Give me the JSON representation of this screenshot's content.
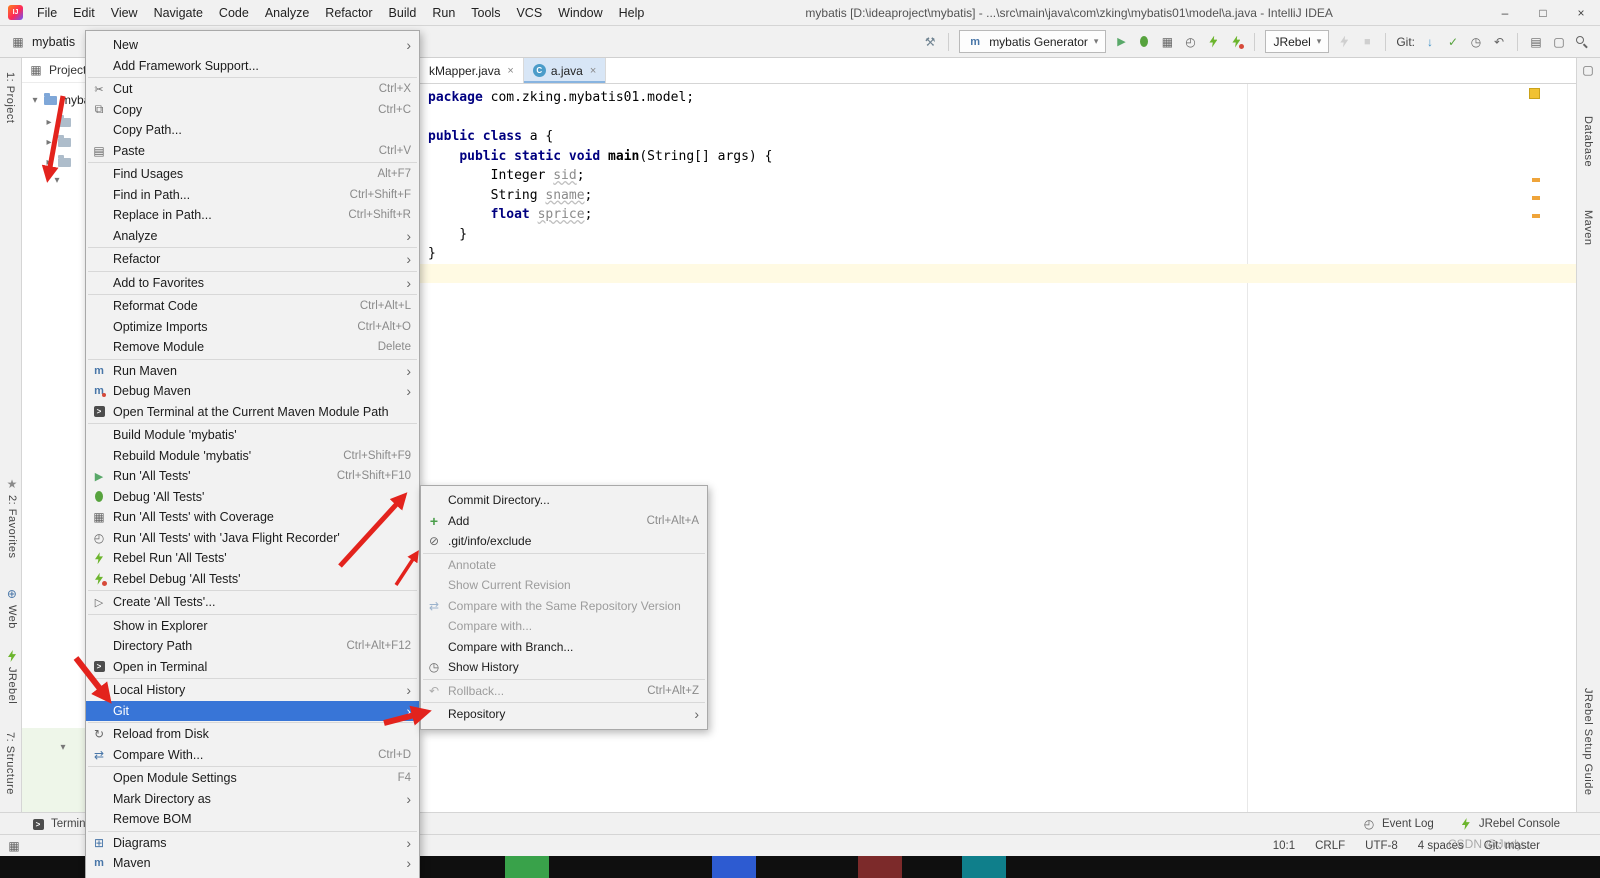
{
  "title_bar": {
    "menus": [
      "File",
      "Edit",
      "View",
      "Navigate",
      "Code",
      "Analyze",
      "Refactor",
      "Build",
      "Run",
      "Tools",
      "VCS",
      "Window",
      "Help"
    ],
    "title": "mybatis [D:\\ideaproject\\mybatis] - ...\\src\\main\\java\\com\\zking\\mybatis01\\model\\a.java - IntelliJ IDEA"
  },
  "toolbar": {
    "project_name": "mybatis",
    "items": [
      {
        "type": "icon",
        "name": "build-hammer-icon"
      },
      {
        "type": "sep"
      },
      {
        "type": "combo",
        "name": "run-config-select",
        "icon": "maven-icon",
        "label": "mybatis Generator"
      },
      {
        "type": "icon",
        "name": "run-icon"
      },
      {
        "type": "icon",
        "name": "debug-icon"
      },
      {
        "type": "icon",
        "name": "coverage-icon"
      },
      {
        "type": "icon",
        "name": "profiler-icon"
      },
      {
        "type": "icon",
        "name": "rebel-run-icon"
      },
      {
        "type": "icon",
        "name": "rebel-debug-icon"
      },
      {
        "type": "sep"
      },
      {
        "type": "combo",
        "name": "jrebel-select",
        "label": "JRebel"
      },
      {
        "type": "icon",
        "name": "rebel-sync-icon",
        "disabled": true
      },
      {
        "type": "icon",
        "name": "stop-icon",
        "disabled": true
      },
      {
        "type": "sep"
      },
      {
        "type": "label",
        "name": "git-label",
        "text": "Git:"
      },
      {
        "type": "icon",
        "name": "git-update-icon"
      },
      {
        "type": "icon",
        "name": "git-commit-icon"
      },
      {
        "type": "icon",
        "name": "git-history-icon"
      },
      {
        "type": "icon",
        "name": "git-revert-icon"
      },
      {
        "type": "sep"
      },
      {
        "type": "icon",
        "name": "open-module-icon"
      },
      {
        "type": "icon",
        "name": "layout-icon"
      },
      {
        "type": "icon",
        "name": "search-icon"
      }
    ]
  },
  "left_strip": [
    {
      "label": "1: Project"
    },
    {
      "label": "2: Favorites",
      "icon": "star-icon"
    },
    {
      "label": "Web",
      "icon": "globe-icon"
    },
    {
      "label": "JRebel",
      "icon": "bolt-icon"
    },
    {
      "label": "7: Structure"
    }
  ],
  "right_strip": [
    {
      "label": "Database"
    },
    {
      "label": "Maven"
    },
    {
      "label": "JRebel Setup Guide"
    }
  ],
  "project_panel": {
    "header": "Project",
    "root_label": "mybatis",
    "children": [
      {
        "label": ""
      },
      {
        "label": ""
      },
      {
        "label": ""
      }
    ]
  },
  "context_menu": {
    "items": [
      {
        "label": "New",
        "submenu": true
      },
      {
        "label": "Add Framework Support..."
      },
      {
        "sep": true
      },
      {
        "label": "Cut",
        "shortcut": "Ctrl+X",
        "icon": "scissors-icon"
      },
      {
        "label": "Copy",
        "shortcut": "Ctrl+C",
        "icon": "copy-icon"
      },
      {
        "label": "Copy Path..."
      },
      {
        "label": "Paste",
        "shortcut": "Ctrl+V",
        "icon": "paste-icon"
      },
      {
        "sep": true
      },
      {
        "label": "Find Usages",
        "shortcut": "Alt+F7"
      },
      {
        "label": "Find in Path...",
        "shortcut": "Ctrl+Shift+F"
      },
      {
        "label": "Replace in Path...",
        "shortcut": "Ctrl+Shift+R"
      },
      {
        "label": "Analyze",
        "submenu": true
      },
      {
        "sep": true
      },
      {
        "label": "Refactor",
        "submenu": true
      },
      {
        "sep": true
      },
      {
        "label": "Add to Favorites",
        "submenu": true
      },
      {
        "sep": true
      },
      {
        "label": "Reformat Code",
        "shortcut": "Ctrl+Alt+L"
      },
      {
        "label": "Optimize Imports",
        "shortcut": "Ctrl+Alt+O"
      },
      {
        "label": "Remove Module",
        "shortcut": "Delete"
      },
      {
        "sep": true
      },
      {
        "label": "Run Maven",
        "icon": "maven-icon",
        "submenu": true
      },
      {
        "label": "Debug Maven",
        "icon": "maven-debug-icon",
        "submenu": true
      },
      {
        "label": "Open Terminal at the Current Maven Module Path",
        "icon": "terminal-icon"
      },
      {
        "sep": true
      },
      {
        "label": "Build Module 'mybatis'"
      },
      {
        "label": "Rebuild Module 'mybatis'",
        "shortcut": "Ctrl+Shift+F9"
      },
      {
        "label": "Run 'All Tests'",
        "shortcut": "Ctrl+Shift+F10",
        "icon": "run-icon"
      },
      {
        "label": "Debug 'All Tests'",
        "icon": "debug-icon"
      },
      {
        "label": "Run 'All Tests' with Coverage",
        "icon": "coverage-icon"
      },
      {
        "label": "Run 'All Tests' with 'Java Flight Recorder'",
        "icon": "profiler-icon"
      },
      {
        "label": "Rebel Run 'All Tests'",
        "icon": "rebel-run-icon"
      },
      {
        "label": "Rebel Debug 'All Tests'",
        "icon": "rebel-debug-icon"
      },
      {
        "sep": true
      },
      {
        "label": "Create 'All Tests'...",
        "icon": "create-run-icon"
      },
      {
        "sep": true
      },
      {
        "label": "Show in Explorer"
      },
      {
        "label": "Directory Path",
        "shortcut": "Ctrl+Alt+F12"
      },
      {
        "label": "Open in Terminal",
        "icon": "terminal-icon"
      },
      {
        "sep": true
      },
      {
        "label": "Local History",
        "submenu": true
      },
      {
        "label": "Git",
        "submenu": true,
        "selected": true
      },
      {
        "sep": true
      },
      {
        "label": "Reload from Disk",
        "icon": "refresh-icon"
      },
      {
        "label": "Compare With...",
        "shortcut": "Ctrl+D",
        "icon": "compare-icon"
      },
      {
        "sep": true
      },
      {
        "label": "Open Module Settings",
        "shortcut": "F4"
      },
      {
        "label": "Mark Directory as",
        "submenu": true
      },
      {
        "label": "Remove BOM"
      },
      {
        "sep": true
      },
      {
        "label": "Diagrams",
        "icon": "diagram-icon",
        "submenu": true
      },
      {
        "label": "Maven",
        "icon": "maven-icon",
        "submenu": true
      }
    ]
  },
  "git_submenu": {
    "items": [
      {
        "label": "Commit Directory..."
      },
      {
        "label": "Add",
        "shortcut": "Ctrl+Alt+A",
        "icon": "plus-icon"
      },
      {
        "label": ".git/info/exclude",
        "icon": "ignore-icon"
      },
      {
        "sep": true
      },
      {
        "label": "Annotate",
        "enabled": false
      },
      {
        "label": "Show Current Revision",
        "enabled": false
      },
      {
        "label": "Compare with the Same Repository Version",
        "icon": "compare-icon",
        "enabled": false
      },
      {
        "label": "Compare with...",
        "enabled": false
      },
      {
        "label": "Compare with Branch..."
      },
      {
        "label": "Show History",
        "icon": "history-icon"
      },
      {
        "sep": true
      },
      {
        "label": "Rollback...",
        "shortcut": "Ctrl+Alt+Z",
        "icon": "rollback-icon",
        "enabled": false
      },
      {
        "sep": true
      },
      {
        "label": "Repository",
        "submenu": true
      }
    ]
  },
  "editor": {
    "tabs": [
      {
        "label": "kMapper.java",
        "selected": false
      },
      {
        "label": "a.java",
        "icon": "class-icon",
        "selected": true
      }
    ],
    "caret_line": 10,
    "code_lines": [
      [
        {
          "t": "k",
          "s": "package"
        },
        {
          "t": "p",
          "s": " com.zking.mybatis01.model;"
        }
      ],
      [],
      [
        {
          "t": "k",
          "s": "public"
        },
        {
          "t": "p",
          "s": " "
        },
        {
          "t": "k",
          "s": "class"
        },
        {
          "t": "p",
          "s": " a {"
        }
      ],
      [
        {
          "t": "p",
          "s": "    "
        },
        {
          "t": "k",
          "s": "public"
        },
        {
          "t": "p",
          "s": " "
        },
        {
          "t": "k",
          "s": "static"
        },
        {
          "t": "p",
          "s": " "
        },
        {
          "t": "k",
          "s": "void"
        },
        {
          "t": "p",
          "s": " "
        },
        {
          "t": "f",
          "s": "main"
        },
        {
          "t": "p",
          "s": "(String[] args) {"
        }
      ],
      [
        {
          "t": "p",
          "s": "        Integer "
        },
        {
          "t": "v",
          "s": "sid"
        },
        {
          "t": "p",
          "s": ";"
        }
      ],
      [
        {
          "t": "p",
          "s": "        String "
        },
        {
          "t": "v",
          "s": "sname"
        },
        {
          "t": "p",
          "s": ";"
        }
      ],
      [
        {
          "t": "p",
          "s": "        "
        },
        {
          "t": "k",
          "s": "float"
        },
        {
          "t": "p",
          "s": " "
        },
        {
          "t": "v",
          "s": "sprice"
        },
        {
          "t": "p",
          "s": ";"
        }
      ],
      [
        {
          "t": "p",
          "s": "    }"
        }
      ],
      [
        {
          "t": "p",
          "s": "}"
        }
      ],
      []
    ]
  },
  "tool_window_bar": {
    "terminal": "Terminal",
    "event_log": "Event Log",
    "jrebel_console": "JRebel Console"
  },
  "status_bar": {
    "caret": "10:1",
    "line_sep": "CRLF",
    "encoding": "UTF-8",
    "indent": "4 spaces",
    "branch": "Git: master"
  },
  "watermark": "CSDN @Judy...",
  "taskbar_blocks": [
    "#39a24a",
    "#2d5bd1",
    "#7c2a2a",
    "#0f7f8b"
  ],
  "colors": {
    "selection_blue": "#3875d7",
    "caret_line_bg": "#fffae3",
    "keyword": "#000080",
    "annotation_arrow_red": "#e3231d",
    "run_green": "#59a869"
  }
}
